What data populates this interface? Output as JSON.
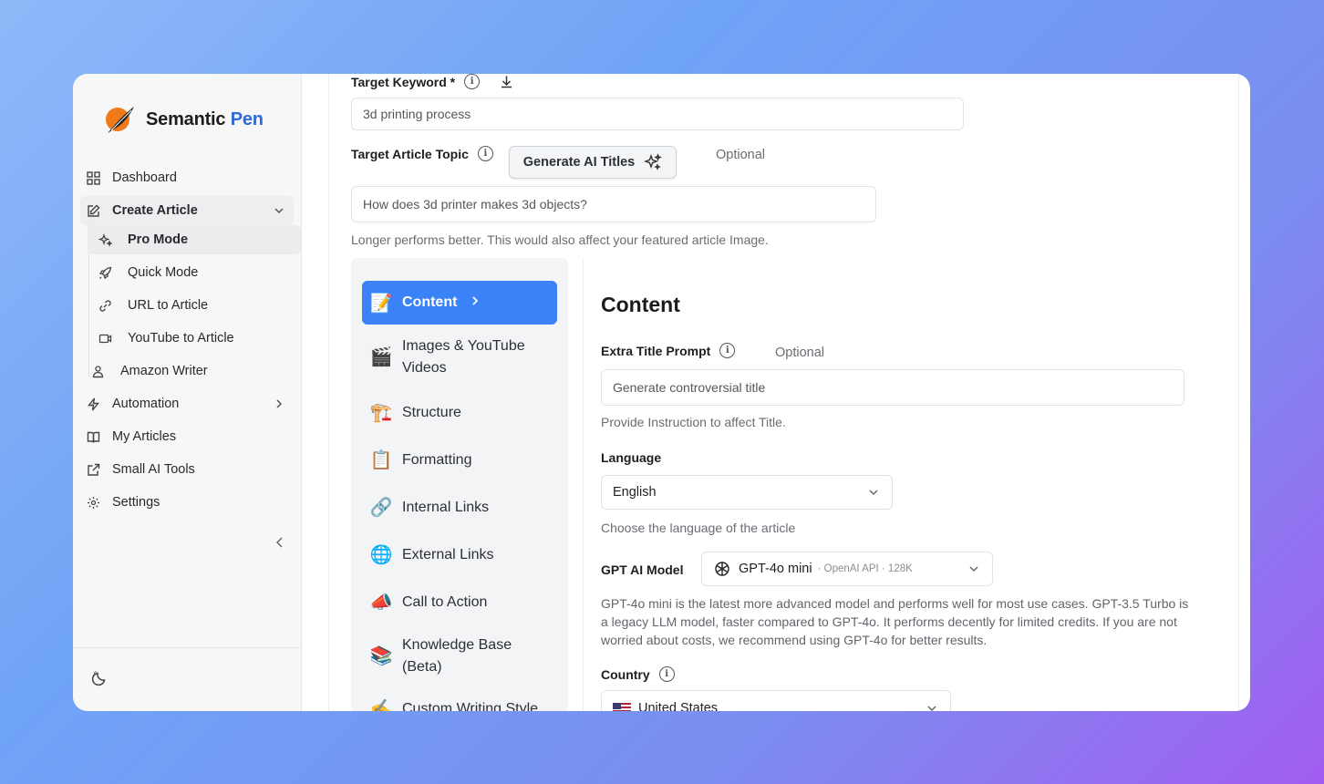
{
  "brand": {
    "name_main": "Semantic",
    "name_accent": "Pen"
  },
  "sidebar": {
    "items": [
      {
        "label": "Dashboard"
      },
      {
        "label": "Create Article"
      },
      {
        "label": "Automation"
      },
      {
        "label": "My Articles"
      },
      {
        "label": "Small AI Tools"
      },
      {
        "label": "Settings"
      }
    ],
    "sub_items": [
      {
        "label": "Pro Mode"
      },
      {
        "label": "Quick Mode"
      },
      {
        "label": "URL to Article"
      },
      {
        "label": "YouTube to Article"
      },
      {
        "label": "Amazon Writer"
      }
    ]
  },
  "form": {
    "target_keyword_label": "Target Keyword *",
    "target_keyword_value": "3d printing process",
    "target_topic_label": "Target Article Topic",
    "generate_button": "Generate AI Titles",
    "optional": "Optional",
    "topic_value": "How does 3d printer makes 3d objects?",
    "topic_hint": "Longer performs better. This would also affect your featured article Image."
  },
  "tabs": [
    {
      "label": "Content",
      "emoji": "📝"
    },
    {
      "label": "Images & YouTube Videos",
      "line1": "Images & YouTube",
      "line2": "Videos",
      "emoji": "🎬"
    },
    {
      "label": "Structure",
      "emoji": "🏗️"
    },
    {
      "label": "Formatting",
      "emoji": "📋"
    },
    {
      "label": "Internal Links",
      "emoji": "🔗"
    },
    {
      "label": "External Links",
      "emoji": "🌐"
    },
    {
      "label": "Call to Action",
      "emoji": "📣"
    },
    {
      "label": "Knowledge Base (Beta)",
      "line1": "Knowledge Base",
      "line2": "(Beta)",
      "emoji": "📚"
    },
    {
      "label": "Custom Writing Style",
      "emoji": "✍️"
    }
  ],
  "content": {
    "title": "Content",
    "extra_title_label": "Extra Title Prompt",
    "optional": "Optional",
    "extra_title_placeholder": "Generate controversial title",
    "extra_title_hint": "Provide Instruction to affect Title.",
    "language_label": "Language",
    "language_value": "English",
    "language_hint": "Choose the language of the article",
    "model_label": "GPT AI Model",
    "model_value": "GPT-4o mini",
    "model_meta": "· OpenAI API · 128K",
    "model_desc": "GPT-4o mini is the latest more advanced model and performs well for most use cases. GPT-3.5 Turbo is a legacy LLM model, faster compared to GPT-4o. It performs decently for limited credits. If you are not worried about costs, we recommend using GPT-4o for better results.",
    "country_label": "Country",
    "country_value": "United States"
  }
}
